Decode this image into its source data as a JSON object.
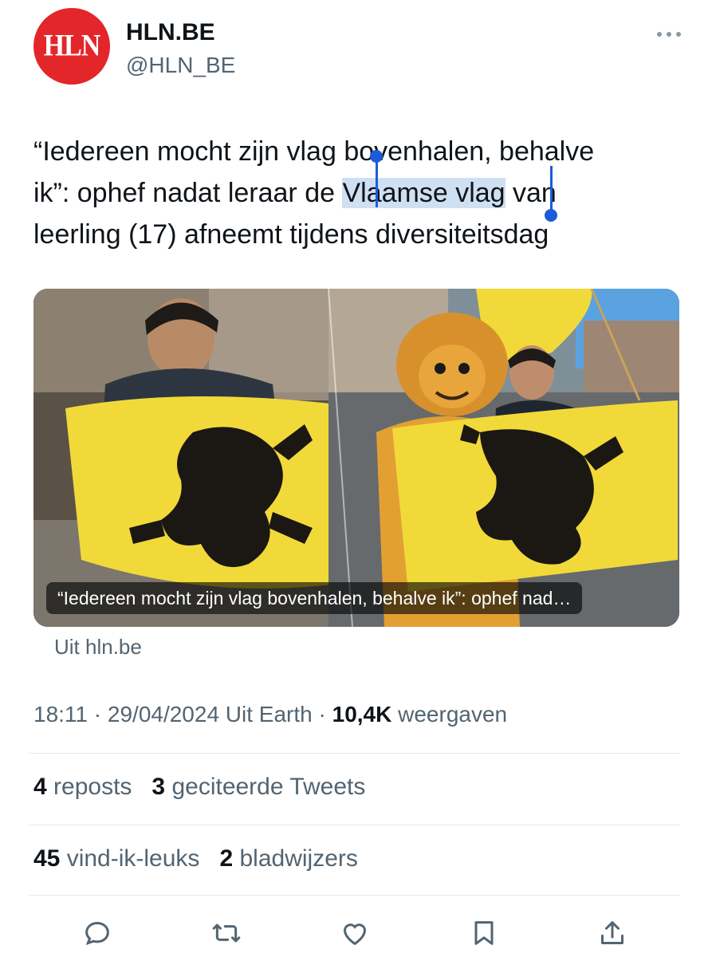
{
  "account": {
    "avatar_text": "HLN",
    "name": "HLN.BE",
    "handle": "@HLN_BE",
    "more_icon": "more-horizontal-icon"
  },
  "tweet": {
    "line1_a": "“Iedereen mocht zijn vlag ",
    "line1_b": "bovenhalen, behalve",
    "line2_a": "ik”: ophef nadat leraar de ",
    "line2_sel": "Vlaamse vlag",
    "line2_b": " van",
    "line3": "leerling (17) afneemt tijdens diversiteitsdag"
  },
  "card": {
    "caption": "“Iedereen mocht zijn vlag bovenhalen, behalve ik”: ophef nad…",
    "source": "Uit hln.be"
  },
  "meta": {
    "time": "18:11",
    "sep1": " · ",
    "date": "29/04/2024",
    "client": " Uit Earth",
    "sep2": " · ",
    "views_count": "10,4K",
    "views_label": " weergaven"
  },
  "stats": {
    "reposts_count": "4",
    "reposts_label": " reposts",
    "quotes_count": "3",
    "quotes_label": " geciteerde Tweets",
    "likes_count": "45",
    "likes_label": " vind-ik-leuks",
    "bookmarks_count": "2",
    "bookmarks_label": " bladwijzers"
  },
  "actions": [
    "reply-icon",
    "retweet-icon",
    "like-icon",
    "bookmark-icon",
    "share-icon"
  ],
  "colors": {
    "flag_yellow": "#f2d93a",
    "lion_black": "#1b1712",
    "selection": "#cfe0f2",
    "caret": "#1d5bd8",
    "avatar_red": "#e3262a"
  }
}
